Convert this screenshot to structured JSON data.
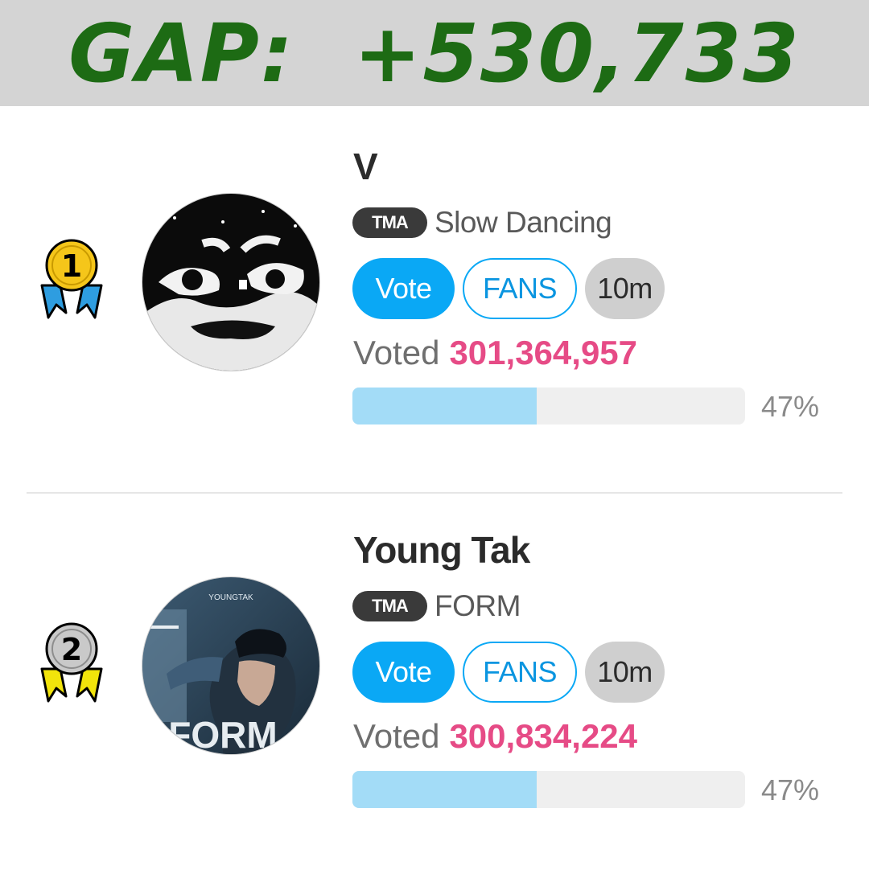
{
  "banner": {
    "gap_label": "GAP:",
    "gap_value": "+530,733"
  },
  "entries": [
    {
      "rank": "1",
      "medal_circle_color": "#f5c61a",
      "medal_ribbon_color": "#2e9de0",
      "avatar": "V profile photo",
      "name": "V",
      "badge": "TMA",
      "song": "Slow Dancing",
      "vote_label": "Vote",
      "fans_label": "FANS",
      "time_label": "10m",
      "voted_label": "Voted",
      "votes": "301,364,957",
      "progress": 0.47,
      "percent": "47%"
    },
    {
      "rank": "2",
      "medal_circle_color": "#c9c9c9",
      "medal_ribbon_color": "#f2e40b",
      "avatar": "Young Tak FORM album cover",
      "avatar_text": "YOUNGTAK",
      "avatar_text_large": "FORM",
      "name": "Young Tak",
      "badge": "TMA",
      "song": "FORM",
      "vote_label": "Vote",
      "fans_label": "FANS",
      "time_label": "10m",
      "voted_label": "Voted",
      "votes": "300,834,224",
      "progress": 0.47,
      "percent": "47%"
    }
  ],
  "colors": {
    "gap_text": "#1d6b14",
    "banner_bg": "#d4d4d4",
    "vote_button": "#0aa8f5",
    "votes_count": "#e64b86",
    "progress_fill": "#a3dcf7"
  },
  "icons": [
    "medal-icon",
    "avatar-image"
  ]
}
